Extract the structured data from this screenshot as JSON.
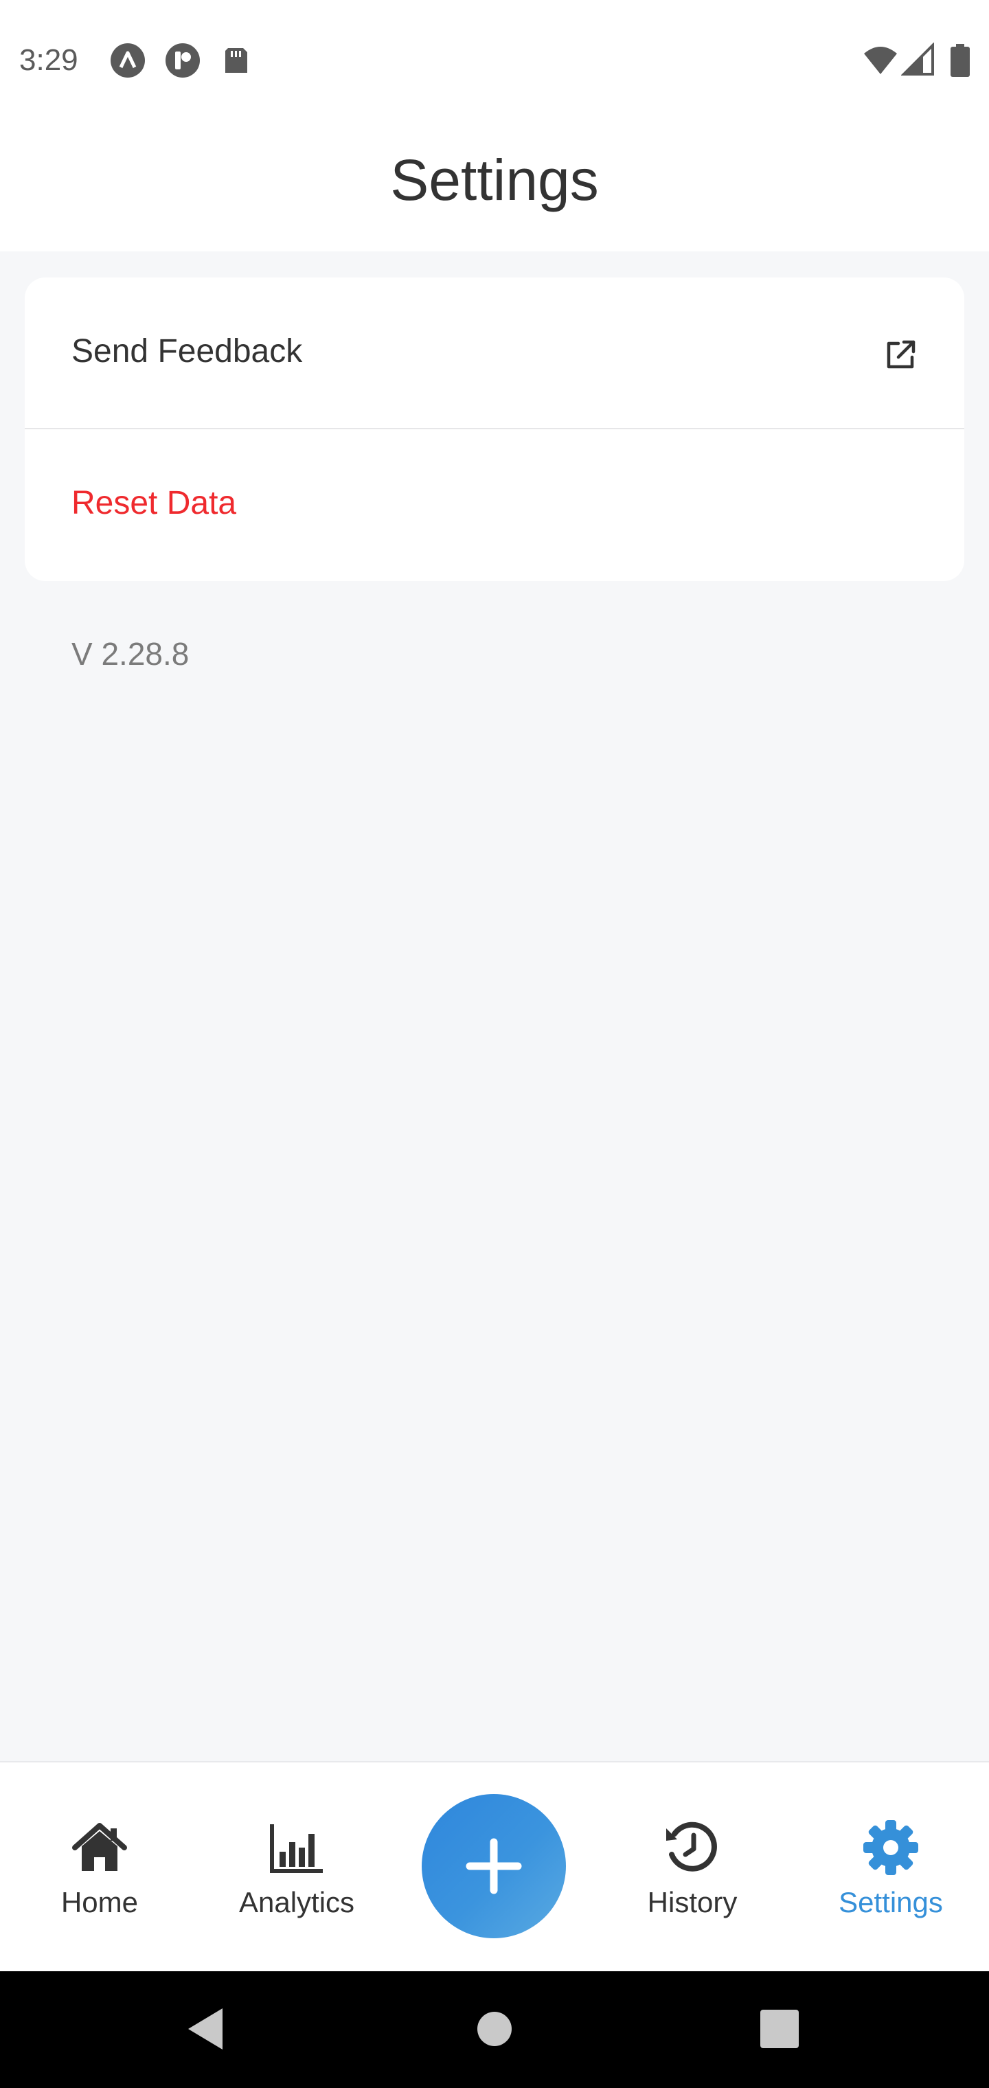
{
  "status_bar": {
    "time": "3:29",
    "icons": [
      "app-a-icon",
      "app-p-icon",
      "sd-card-icon",
      "wifi-icon",
      "cell-signal-icon",
      "battery-icon"
    ]
  },
  "header": {
    "title": "Settings"
  },
  "settings": {
    "items": [
      {
        "label": "Send Feedback",
        "icon": "external-link-icon",
        "color": "#333333"
      },
      {
        "label": "Reset Data",
        "color": "#ef2a2e"
      }
    ]
  },
  "version": "V 2.28.8",
  "bottom_nav": {
    "items": [
      {
        "label": "Home",
        "icon": "home-icon",
        "active": false
      },
      {
        "label": "Analytics",
        "icon": "bar-chart-icon",
        "active": false
      },
      {
        "label": "History",
        "icon": "history-icon",
        "active": false
      },
      {
        "label": "Settings",
        "icon": "gear-icon",
        "active": true
      }
    ],
    "fab_icon": "plus-icon"
  },
  "colors": {
    "accent": "#3590d9",
    "danger": "#ef2a2e",
    "background": "#f6f7f9",
    "text": "#333333",
    "muted": "#7b7b7b"
  }
}
